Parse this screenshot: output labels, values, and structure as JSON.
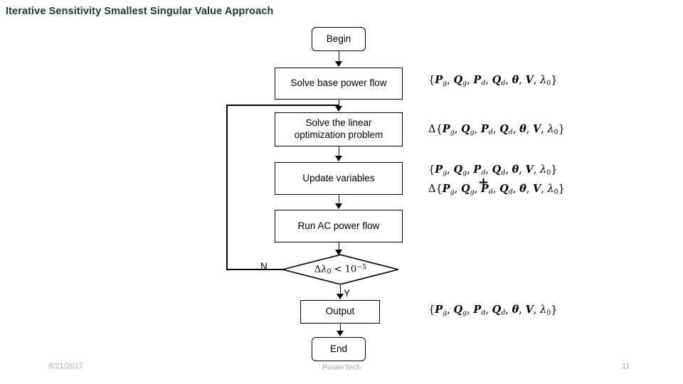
{
  "slide": {
    "title": "Iterative Sensitivity Smallest Singular Value Approach",
    "footer": {
      "date": "6/21/2017",
      "center": "PowerTech",
      "page_number": "11"
    }
  },
  "flowchart": {
    "nodes": [
      {
        "id": "begin",
        "label": "Begin",
        "shape": "rounded-rect"
      },
      {
        "id": "solve_base",
        "label": "Solve base power flow",
        "shape": "rect"
      },
      {
        "id": "solve_linear",
        "label": "Solve the linear\noptimization problem",
        "line1": "Solve the linear",
        "line2": "optimization problem",
        "shape": "rect"
      },
      {
        "id": "update_vars",
        "label": "Update variables",
        "shape": "rect"
      },
      {
        "id": "run_ac",
        "label": "Run AC power flow",
        "shape": "rect"
      },
      {
        "id": "decision",
        "label": "Δλ₀ < 10⁻⁵",
        "shape": "diamond"
      },
      {
        "id": "output",
        "label": "Output",
        "shape": "rect"
      },
      {
        "id": "end",
        "label": "End",
        "shape": "rounded-rect"
      }
    ],
    "branch_labels": {
      "no": "N",
      "yes": "Y"
    }
  },
  "annotations": {
    "set_base": "{Pg, Qg, Pd, Qd, θ, V, λ0}",
    "set_delta": "Δ{Pg, Qg, Pd, Qd, θ, V, λ0}",
    "set_update_top": "{Pg, Qg, Pd, Qd, θ, V, λ0}",
    "set_update_bottom": "Δ{Pg, Qg, Pd, Qd, θ, V, λ0}",
    "plus": "+",
    "set_output": "{Pg, Qg, Pd, Qd, θ, V, λ0}",
    "decision_condition": "Δλ0 < 10^-5"
  }
}
